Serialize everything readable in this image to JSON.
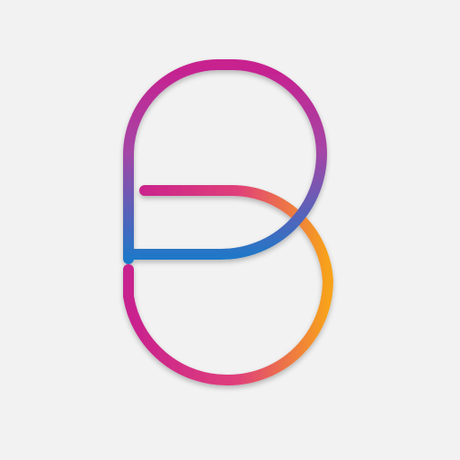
{
  "logo": {
    "icon": "letter-b-logo-icon",
    "background_color": "#f2f2f2",
    "colors": {
      "magenta": "#c8208f",
      "purple": "#9a4aa8",
      "blue": "#1e78c8",
      "pink": "#e0407a",
      "orange": "#f7a21b"
    }
  }
}
